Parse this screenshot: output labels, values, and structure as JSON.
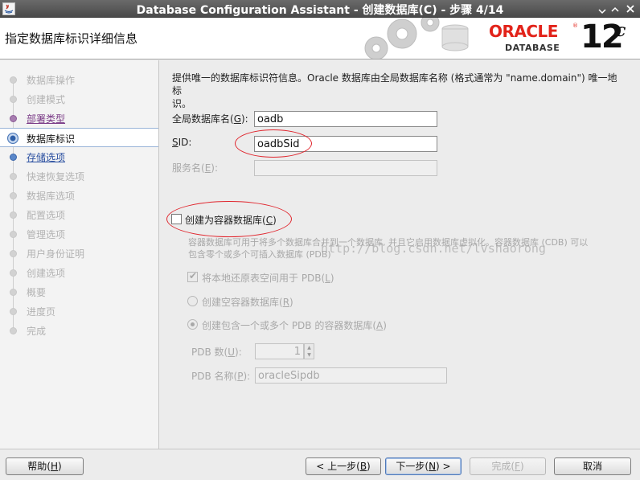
{
  "window": {
    "title": "Database Configuration Assistant - 创建数据库(C) - 步骤 4/14"
  },
  "header": {
    "page_title": "指定数据库标识详细信息",
    "brand_word": "ORACLE",
    "brand_sub": "DATABASE",
    "version": "12",
    "version_sup": "c"
  },
  "nav": {
    "items": [
      {
        "label": "数据库操作",
        "state": "disabled"
      },
      {
        "label": "创建模式",
        "state": "disabled"
      },
      {
        "label": "部署类型",
        "state": "done"
      },
      {
        "label": "数据库标识",
        "state": "active"
      },
      {
        "label": "存储选项",
        "state": "link"
      },
      {
        "label": "快速恢复选项",
        "state": "disabled"
      },
      {
        "label": "数据库选项",
        "state": "disabled"
      },
      {
        "label": "配置选项",
        "state": "disabled"
      },
      {
        "label": "管理选项",
        "state": "disabled"
      },
      {
        "label": "用户身份证明",
        "state": "disabled"
      },
      {
        "label": "创建选项",
        "state": "disabled"
      },
      {
        "label": "概要",
        "state": "disabled"
      },
      {
        "label": "进度页",
        "state": "disabled"
      },
      {
        "label": "完成",
        "state": "disabled"
      }
    ]
  },
  "form": {
    "intro_line1": "提供唯一的数据库标识符信息。Oracle 数据库由全局数据库名称 (格式通常为 \"name.domain\") 唯一地标",
    "intro_line2": "识。",
    "global_name": {
      "label_pre": "全局数据库名(",
      "mnemonic": "G",
      "label_post": "):",
      "value": "oadb"
    },
    "sid": {
      "label_pre": "",
      "mnemonic": "S",
      "label_post": "ID:",
      "value": "oadbSid"
    },
    "service_name": {
      "label_pre": "服务名(",
      "mnemonic": "E",
      "label_post": "):",
      "value": ""
    },
    "container": {
      "checkbox_label_pre": "创建为容器数据库(",
      "checkbox_mnemonic": "C",
      "checkbox_label_post": ")",
      "checked": false,
      "description_line1": "容器数据库可用于将多个数据库合并到一个数据库, 并且它启用数据库虚拟化。容器数据库 (CDB) 可以",
      "description_line2": "包含零个或多个可插入数据库 (PDB)",
      "local_undo": {
        "label_pre": "将本地还原表空间用于 PDB(",
        "mnemonic": "L",
        "label_post": ")",
        "checked": true
      },
      "empty_cdb": {
        "label_pre": "创建空容器数据库(",
        "mnemonic": "R",
        "label_post": ")",
        "selected": false
      },
      "with_pdb": {
        "label_pre": "创建包含一个或多个 PDB 的容器数据库(",
        "mnemonic": "A",
        "label_post": ")",
        "selected": true
      },
      "pdb_count": {
        "label_pre": "PDB 数(",
        "mnemonic": "U",
        "label_post": "):",
        "value": "1"
      },
      "pdb_name": {
        "label_pre": "PDB 名称(",
        "mnemonic": "P",
        "label_post": "):",
        "value": "oracleSipdb"
      }
    },
    "watermark": "http://blog.csdn.net/lvshaorong"
  },
  "footer": {
    "help": {
      "pre": "帮助(",
      "mn": "H",
      "post": ")"
    },
    "back": {
      "pre": "< 上一步(",
      "mn": "B",
      "post": ")"
    },
    "next": {
      "pre": "下一步(",
      "mn": "N",
      "post": ") >"
    },
    "finish": {
      "pre": "完成(",
      "mn": "F",
      "post": ")"
    },
    "cancel": {
      "label": "取消"
    }
  },
  "colors": {
    "oracle_red": "#e2231a",
    "annotation_red": "#e0242c",
    "link_blue": "#2a4fa0",
    "visited_purple": "#7a3a86"
  }
}
